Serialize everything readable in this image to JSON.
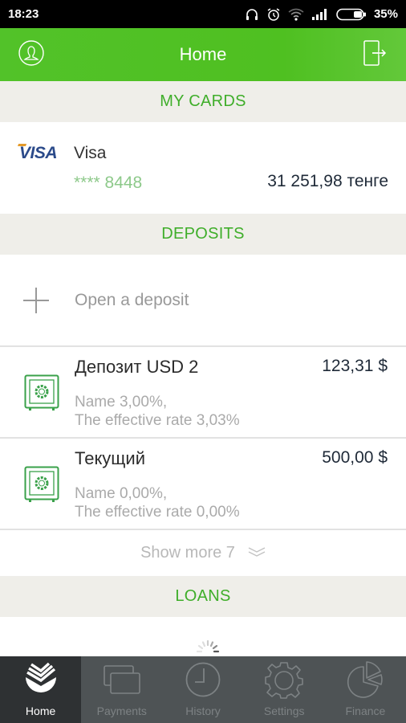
{
  "status_bar": {
    "time": "18:23",
    "battery": "35%",
    "icons": [
      "headset-icon",
      "alarm-icon",
      "wifi-icon",
      "signal-icon",
      "battery-icon"
    ]
  },
  "header": {
    "title": "Home",
    "left_icon": "profile-icon",
    "right_icon": "logout-icon"
  },
  "sections": {
    "cards": "MY CARDS",
    "deposits": "DEPOSITS",
    "loans": "LOANS"
  },
  "cards": [
    {
      "brand": "VISA",
      "name": "Visa",
      "number": "**** 8448",
      "balance": "31 251,98 тенге"
    }
  ],
  "open_deposit": {
    "label": "Open a deposit",
    "icon": "plus-icon"
  },
  "deposits": [
    {
      "name": "Депозит USD 2",
      "amount": "123,31 $",
      "rate_line1": "Name 3,00%,",
      "rate_line2": "The effective rate 3,03%",
      "icon": "safe-icon"
    },
    {
      "name": "Текущий",
      "amount": "500,00 $",
      "rate_line1": "Name 0,00%,",
      "rate_line2": "The effective rate 0,00%",
      "icon": "safe-icon"
    }
  ],
  "show_more": {
    "label": "Show more 7",
    "icon": "double-chevron-down-icon"
  },
  "bottom_nav": [
    {
      "label": "Home",
      "icon": "bank-logo-icon",
      "active": true
    },
    {
      "label": "Payments",
      "icon": "cards-icon",
      "active": false
    },
    {
      "label": "History",
      "icon": "clock-icon",
      "active": false
    },
    {
      "label": "Settings",
      "icon": "gear-icon",
      "active": false
    },
    {
      "label": "Finance",
      "icon": "pie-chart-icon",
      "active": false
    }
  ],
  "colors": {
    "brand_green": "#52c229",
    "section_text": "#3fae2a",
    "section_bg": "#efeee9",
    "card_number": "#8dc98a",
    "nav_bg": "#4e5355",
    "nav_active_bg": "#2e3133"
  }
}
